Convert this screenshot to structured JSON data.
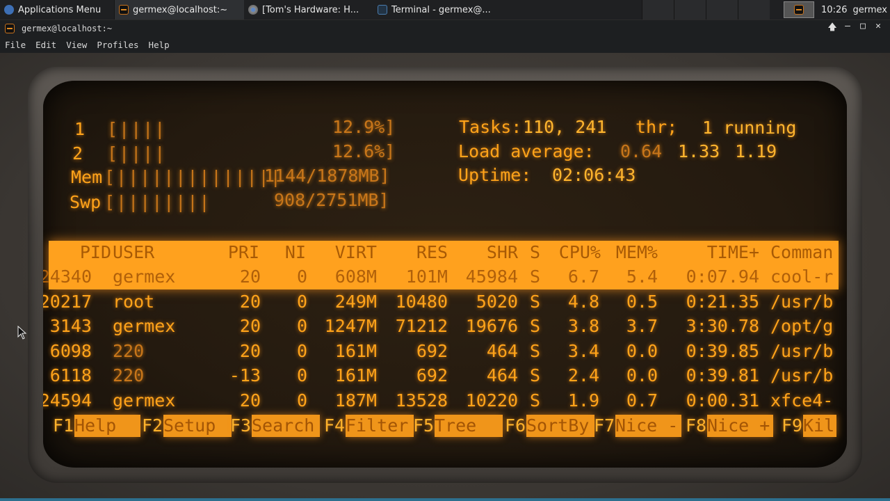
{
  "panel": {
    "apps_menu": "Applications Menu",
    "tasks": [
      {
        "label": "germex@localhost:~",
        "icon": "crt-terminal-icon"
      },
      {
        "label": "[Tom's Hardware: H...",
        "icon": "chromium-icon"
      },
      {
        "label": "Terminal - germex@...",
        "icon": "terminal-icon"
      }
    ],
    "clock": "10:26",
    "username": "germex"
  },
  "window": {
    "title": "germex@localhost:~",
    "menu": [
      "File",
      "Edit",
      "View",
      "Profiles",
      "Help"
    ]
  },
  "htop": {
    "cpu1": {
      "label": "1",
      "bar": "[||||",
      "pct": "12.9%]"
    },
    "cpu2": {
      "label": "2",
      "bar": "[||||",
      "pct": "12.6%]"
    },
    "mem": {
      "label": "Mem",
      "bar": "[||||||||||||||",
      "val": "1144/1878MB]"
    },
    "swp": {
      "label": "Swp",
      "bar": "[||||||||",
      "val": "908/2751MB]"
    },
    "tasks_label": "Tasks:",
    "tasks_value": "110, 241",
    "tasks_thr": "thr;",
    "tasks_running": "1 running",
    "load_label": "Load average:",
    "load_1": "0.64",
    "load_5": "1.33",
    "load_15": "1.19",
    "uptime_label": "Uptime:",
    "uptime_value": "02:06:43",
    "columns": [
      "PID",
      "USER",
      "PRI",
      "NI",
      "VIRT",
      "RES",
      "SHR",
      "S",
      "CPU%",
      "MEM%",
      "TIME+",
      "Comman"
    ],
    "rows": [
      {
        "pid": "24340",
        "user": "germex",
        "pri": "20",
        "ni": "0",
        "virt": "608M",
        "res": "101M",
        "shr": "45984",
        "s": "S",
        "cpu": "6.7",
        "mem": "5.4",
        "time": "0:07.94",
        "cmd": "cool-r"
      },
      {
        "pid": "20217",
        "user": "root",
        "pri": "20",
        "ni": "0",
        "virt": "249M",
        "res": "10480",
        "shr": "5020",
        "s": "S",
        "cpu": "4.8",
        "mem": "0.5",
        "time": "0:21.35",
        "cmd": "/usr/b"
      },
      {
        "pid": "3143",
        "user": "germex",
        "pri": "20",
        "ni": "0",
        "virt": "1247M",
        "res": "71212",
        "shr": "19676",
        "s": "S",
        "cpu": "3.8",
        "mem": "3.7",
        "time": "3:30.78",
        "cmd": "/opt/g"
      },
      {
        "pid": "6098",
        "user": "220",
        "pri": "20",
        "ni": "0",
        "virt": "161M",
        "res": "692",
        "shr": "464",
        "s": "S",
        "cpu": "3.4",
        "mem": "0.0",
        "time": "0:39.85",
        "cmd": "/usr/b"
      },
      {
        "pid": "6118",
        "user": "220",
        "pri": "-13",
        "ni": "0",
        "virt": "161M",
        "res": "692",
        "shr": "464",
        "s": "S",
        "cpu": "2.4",
        "mem": "0.0",
        "time": "0:39.81",
        "cmd": "/usr/b"
      },
      {
        "pid": "24594",
        "user": "germex",
        "pri": "20",
        "ni": "0",
        "virt": "187M",
        "res": "13528",
        "shr": "10220",
        "s": "S",
        "cpu": "1.9",
        "mem": "0.7",
        "time": "0:00.31",
        "cmd": "xfce4-"
      }
    ],
    "fkeys": [
      {
        "key": "F1",
        "label": "Help  "
      },
      {
        "key": "F2",
        "label": "Setup "
      },
      {
        "key": "F3",
        "label": "Search"
      },
      {
        "key": "F4",
        "label": "Filter"
      },
      {
        "key": "F5",
        "label": "Tree  "
      },
      {
        "key": "F6",
        "label": "SortBy"
      },
      {
        "key": "F7",
        "label": "Nice -"
      },
      {
        "key": "F8",
        "label": "Nice +"
      },
      {
        "key": "F9",
        "label": "Kil"
      }
    ]
  },
  "colors": {
    "phosphor": "#ffa31a",
    "panel": "#1f2022",
    "accent": "#2d6f8e"
  }
}
